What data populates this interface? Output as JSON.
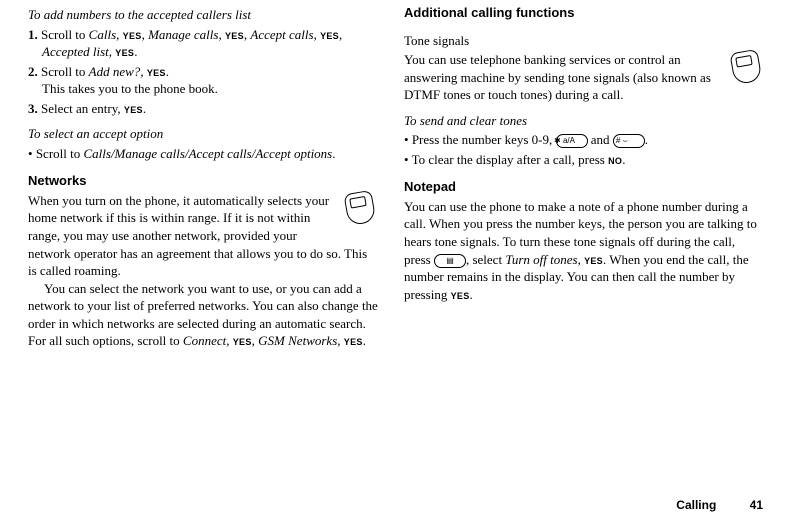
{
  "left": {
    "h1": "To add numbers to the accepted callers list",
    "li1a": "Scroll to ",
    "li1_calls": "Calls",
    "li1b": ", ",
    "li1_yes": "YES",
    "li1c": ", ",
    "li1_manage": "Manage calls",
    "li1d": ", ",
    "li1e": ", ",
    "li1_accept": "Accept calls",
    "li1f": ", ",
    "li1g": ", ",
    "li1_acclist": "Accepted list",
    "li1h": ", ",
    "li1i": ".",
    "li2a": "Scroll to ",
    "li2_add": "Add new?",
    "li2b": ", ",
    "li2c": ".",
    "li2d": "This takes you to the phone book.",
    "li3a": "Select an entry, ",
    "li3b": ".",
    "h2": "To select an accept option",
    "bullet1a": "Scroll to ",
    "bullet1_path": "Calls/Manage calls/Accept calls/Accept options",
    "bullet1b": ".",
    "networks_title": "Networks",
    "networks_p1": "When you turn on the phone, it automatically selects your home network if this is within range. If it is not within range, you may use another network, provided your network operator has an agreement that allows you to do so. This is called roaming.",
    "networks_p2a": "You can select the network you want to use, or you can add a network to your list of preferred networks. You can also change the order in which networks are selected during an automatic search. For all such options, scroll to ",
    "networks_connect": "Connect",
    "networks_p2b": ", ",
    "networks_p2c": ", ",
    "networks_gsm": "GSM Networks",
    "networks_p2d": ", ",
    "networks_p2e": "."
  },
  "right": {
    "h1": "Additional calling functions",
    "tone_title": "Tone signals",
    "tone_body": "You can use telephone banking services or control an answering machine by sending tone signals (also known as DTMF tones or touch tones) during a call.",
    "tones_head": "To send and clear tones",
    "tones_li1a": "Press the number keys 0-9, ",
    "btn_star": "✱ a/A",
    "tones_li1b": " and ",
    "btn_hash": "# ⌣",
    "tones_li1c": ".",
    "tones_li2a": "To clear the display after a call, press ",
    "key_no": "NO",
    "tones_li2b": ".",
    "notepad_title": "Notepad",
    "notepad_p_a": "You can use the phone to make a note of a phone number during a call. When you press the number keys, the person you are talking to hears tone signals. To turn these tone signals off during the call, press ",
    "btn_menu": "▤",
    "notepad_p_b": ", select ",
    "notepad_turnoff": "Turn off tones",
    "notepad_p_c": ", ",
    "key_yes": "YES",
    "notepad_p_d": ". When you end the call, the number remains in the display. You can then call the number by pressing ",
    "notepad_p_e": "."
  },
  "footer": {
    "section": "Calling",
    "page": "41"
  }
}
